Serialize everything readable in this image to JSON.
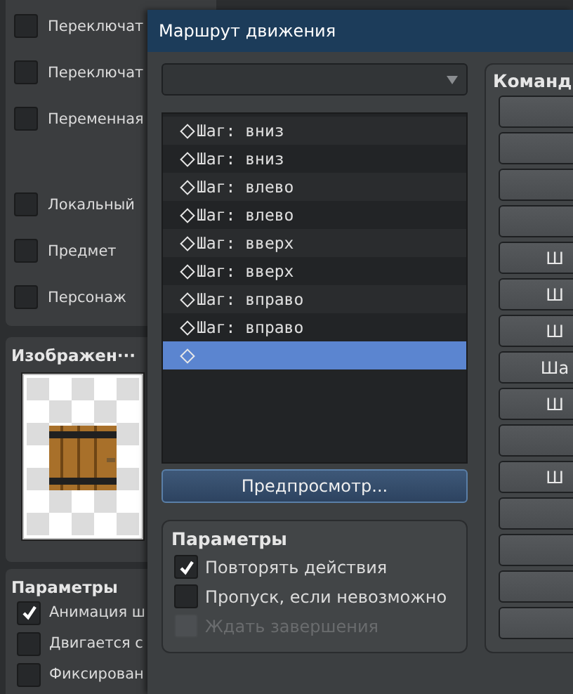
{
  "background_panel": {
    "checkbox_groups": [
      [
        {
          "label": "Переключат",
          "checked": false
        },
        {
          "label": "Переключат",
          "checked": false
        },
        {
          "label": "Переменная",
          "checked": false
        }
      ],
      [
        {
          "label": "Локальный",
          "checked": false
        },
        {
          "label": "Предмет",
          "checked": false
        },
        {
          "label": "Персонаж",
          "checked": false
        }
      ]
    ],
    "image_panel": {
      "title": "Изображен···"
    },
    "parameters": {
      "title": "Параметры",
      "checkboxes": [
        {
          "label": "Анимация ш",
          "checked": true
        },
        {
          "label": "Двигается с",
          "checked": false
        },
        {
          "label": "Фиксирован",
          "checked": false
        }
      ]
    }
  },
  "dialog": {
    "title": "Маршрут движения",
    "route_list": [
      {
        "label": "Шаг: вниз",
        "selected": false
      },
      {
        "label": "Шаг: вниз",
        "selected": false
      },
      {
        "label": "Шаг: влево",
        "selected": false
      },
      {
        "label": "Шаг: влево",
        "selected": false
      },
      {
        "label": "Шаг: вверх",
        "selected": false
      },
      {
        "label": "Шаг: вверх",
        "selected": false
      },
      {
        "label": "Шаг: вправо",
        "selected": false
      },
      {
        "label": "Шаг: вправо",
        "selected": false
      },
      {
        "selected": true
      }
    ],
    "preview_button": "Предпросмотр...",
    "parameters": {
      "title": "Параметры",
      "checkboxes": [
        {
          "label": "Повторять действия",
          "checked": true,
          "disabled": false
        },
        {
          "label": "Пропуск, если невозможно",
          "checked": false,
          "disabled": false
        },
        {
          "label": "Ждать завершения",
          "checked": false,
          "disabled": true
        }
      ]
    },
    "commands": {
      "title": "Команд",
      "buttons": [
        {
          "kind": "blank"
        },
        {
          "kind": "blank"
        },
        {
          "kind": "blank"
        },
        {
          "kind": "blank"
        },
        {
          "kind": "text",
          "label": "Ш"
        },
        {
          "kind": "text",
          "label": "Ш"
        },
        {
          "kind": "text",
          "label": "Ш"
        },
        {
          "kind": "text",
          "label": "Ша"
        },
        {
          "kind": "text",
          "label": "Ш"
        },
        {
          "kind": "blank"
        },
        {
          "kind": "text",
          "label": "Ш"
        },
        {
          "kind": "blank"
        },
        {
          "kind": "blank"
        },
        {
          "kind": "blank"
        },
        {
          "kind": "blank"
        }
      ]
    }
  }
}
